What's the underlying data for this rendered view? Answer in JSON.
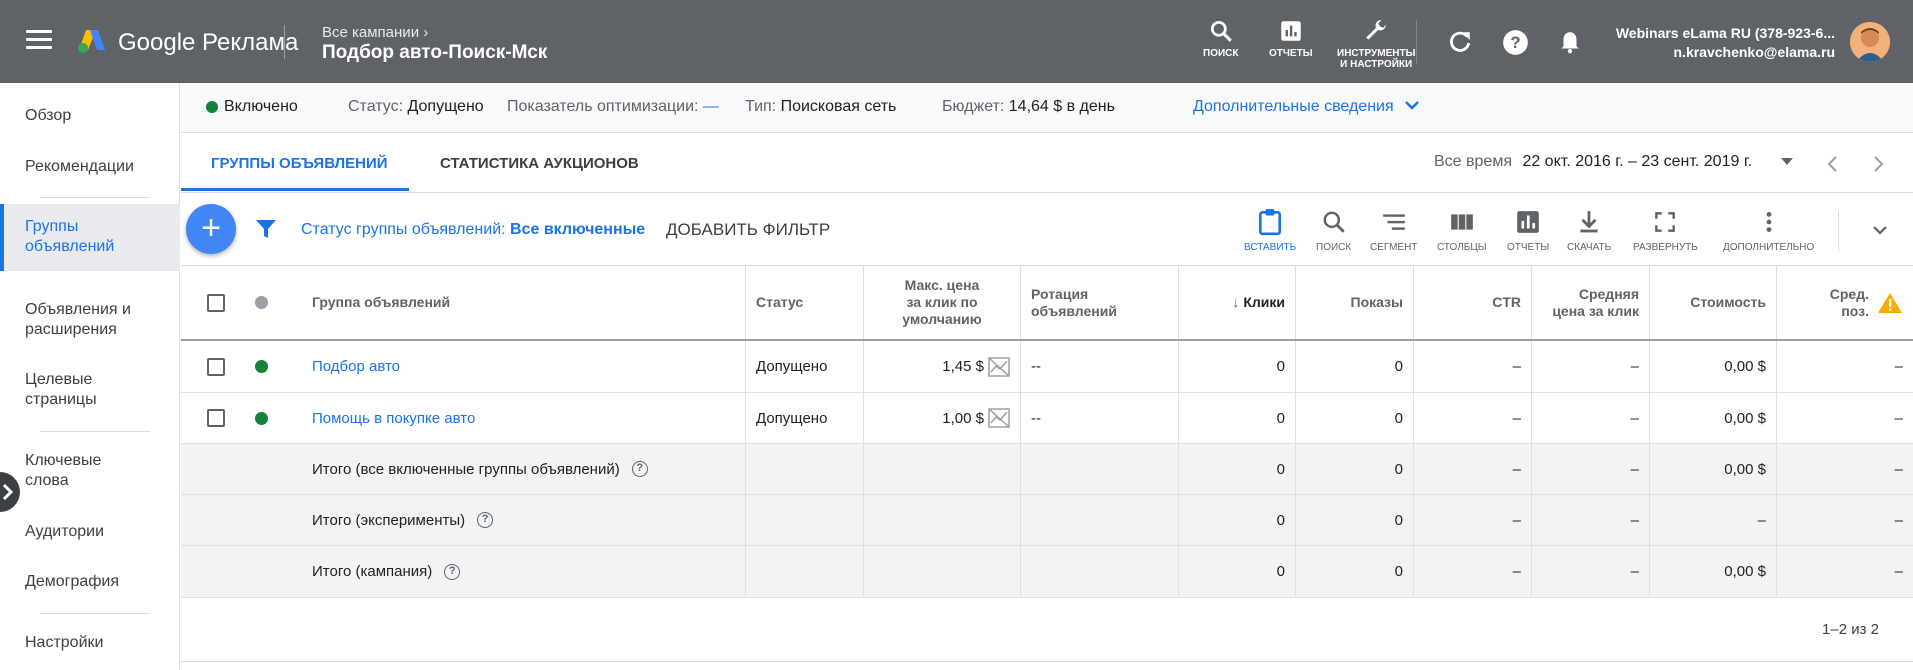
{
  "header": {
    "brand": "Google Реклама",
    "breadcrumb": "Все кампании",
    "campaign": "Подбор авто-Поиск-Мск",
    "tools": [
      {
        "icon": "search-icon",
        "label": "ПОИСК"
      },
      {
        "icon": "reports-icon",
        "label": "ОТЧЕТЫ"
      },
      {
        "icon": "wrench-icon",
        "label_line1": "ИНСТРУМЕНТЫ",
        "label_line2": "И НАСТРОЙКИ"
      }
    ],
    "account_name": "Webinars eLama RU (378-923-6...",
    "account_email": "n.kravchenko@elama.ru"
  },
  "sidebar": {
    "items": [
      {
        "label": "Обзор"
      },
      {
        "label": "Рекомендации"
      },
      {
        "label_line1": "Группы",
        "label_line2": "объявлений"
      },
      {
        "label_line1": "Объявления и",
        "label_line2": "расширения"
      },
      {
        "label_line1": "Целевые",
        "label_line2": "страницы"
      },
      {
        "label_line1": "Ключевые",
        "label_line2": "слова"
      },
      {
        "label": "Аудитории"
      },
      {
        "label": "Демография"
      },
      {
        "label": "Настройки"
      }
    ]
  },
  "status_strip": {
    "enabled": "Включено",
    "status_label": "Статус:",
    "status_value": "Допущено",
    "optimization_label": "Показатель оптимизации:",
    "optimization_value": "—",
    "type_label": "Тип:",
    "type_value": "Поисковая сеть",
    "budget_label": "Бюджет:",
    "budget_value": "14,64 $ в день",
    "more_details": "Дополнительные сведения"
  },
  "tabs": {
    "items": [
      "ГРУППЫ ОБЪЯВЛЕНИЙ",
      "СТАТИСТИКА АУКЦИОНОВ"
    ],
    "date_label": "Все время",
    "date_value": "22 окт. 2016 г. – 23 сент. 2019 г."
  },
  "toolbar": {
    "filter_prefix": "Статус группы объявлений:",
    "filter_value": "Все включенные",
    "add_filter": "ДОБАВИТЬ ФИЛЬТР",
    "tools": [
      "ВСТАВИТЬ",
      "ПОИСК",
      "СЕГМЕНТ",
      "СТОЛБЦЫ",
      "ОТЧЕТЫ",
      "СКАЧАТЬ",
      "РАЗВЕРНУТЬ",
      "ДОПОЛНИТЕЛЬНО"
    ]
  },
  "table": {
    "headers": {
      "group": "Группа объявлений",
      "status": "Статус",
      "max_cpc_1": "Макс. цена",
      "max_cpc_2": "за клик по",
      "max_cpc_3": "умолчанию",
      "rotation_1": "Ротация",
      "rotation_2": "объявлений",
      "clicks": "Клики",
      "impressions": "Показы",
      "ctr": "CTR",
      "avg_cpc_1": "Средняя",
      "avg_cpc_2": "цена за клик",
      "cost": "Стоимость",
      "avg_pos_1": "Сред.",
      "avg_pos_2": "поз."
    },
    "rows": [
      {
        "name": "Подбор авто",
        "status": "Допущено",
        "max_cpc": "1,45 $",
        "rotation": "--",
        "clicks": "0",
        "impressions": "0",
        "ctr": "–",
        "avg_cpc": "–",
        "cost": "0,00 $",
        "avg_pos": "–"
      },
      {
        "name": "Помощь в покупке авто",
        "status": "Допущено",
        "max_cpc": "1,00 $",
        "rotation": "--",
        "clicks": "0",
        "impressions": "0",
        "ctr": "–",
        "avg_cpc": "–",
        "cost": "0,00 $",
        "avg_pos": "–"
      }
    ],
    "totals": [
      {
        "name": "Итого (все включенные группы объявлений)",
        "clicks": "0",
        "impressions": "0",
        "ctr": "–",
        "avg_cpc": "–",
        "cost": "0,00 $",
        "avg_pos": "–"
      },
      {
        "name": "Итого (эксперименты)",
        "clicks": "0",
        "impressions": "0",
        "ctr": "–",
        "avg_cpc": "–",
        "cost": "–",
        "avg_pos": "–"
      },
      {
        "name": "Итого (кампания)",
        "clicks": "0",
        "impressions": "0",
        "ctr": "–",
        "avg_cpc": "–",
        "cost": "0,00 $",
        "avg_pos": "–"
      }
    ],
    "pagination": "1–2 из 2"
  }
}
